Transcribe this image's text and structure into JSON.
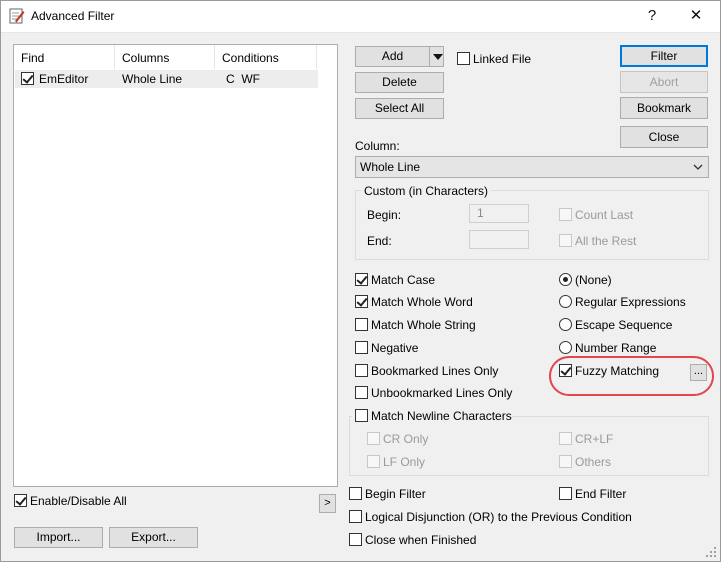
{
  "window": {
    "title": "Advanced Filter",
    "help": "?",
    "close": "✕"
  },
  "list": {
    "headers": [
      "Find",
      "Columns",
      "Conditions"
    ],
    "rows": [
      {
        "checked": true,
        "find": "EmEditor",
        "columns": "Whole Line",
        "conditions": "C  WF"
      }
    ]
  },
  "buttons": {
    "add": "Add",
    "delete": "Delete",
    "select_all": "Select All",
    "filter": "Filter",
    "abort": "Abort",
    "bookmark": "Bookmark",
    "close": "Close",
    "import": "Import...",
    "export": "Export...",
    "more": ">",
    "fuzzy_settings": "..."
  },
  "linked_file": "Linked File",
  "column": {
    "label": "Column:",
    "value": "Whole Line"
  },
  "custom": {
    "title": "Custom (in Characters)",
    "begin_label": "Begin:",
    "begin_value": "1",
    "end_label": "End:",
    "end_value": "",
    "count_last": "Count Last",
    "all_rest": "All the Rest"
  },
  "options": {
    "match_case": "Match Case",
    "match_whole_word": "Match Whole Word",
    "match_whole_string": "Match Whole String",
    "negative": "Negative",
    "bookmarked_only": "Bookmarked Lines Only",
    "unbookmarked_only": "Unbookmarked Lines Only",
    "match_newline": "Match Newline Characters",
    "cr_only": "CR Only",
    "lf_only": "LF Only",
    "crlf": "CR+LF",
    "others": "Others"
  },
  "modes": {
    "none": "(None)",
    "regex": "Regular Expressions",
    "escape": "Escape Sequence",
    "number_range": "Number Range",
    "fuzzy": "Fuzzy Matching"
  },
  "bottom": {
    "enable_all": "Enable/Disable All",
    "begin_filter": "Begin Filter",
    "end_filter": "End Filter",
    "logical_or": "Logical Disjunction (OR) to the Previous Condition",
    "close_when_finished": "Close when Finished"
  },
  "colors": {
    "highlight": "#e0464a",
    "accent": "#0078d7"
  }
}
